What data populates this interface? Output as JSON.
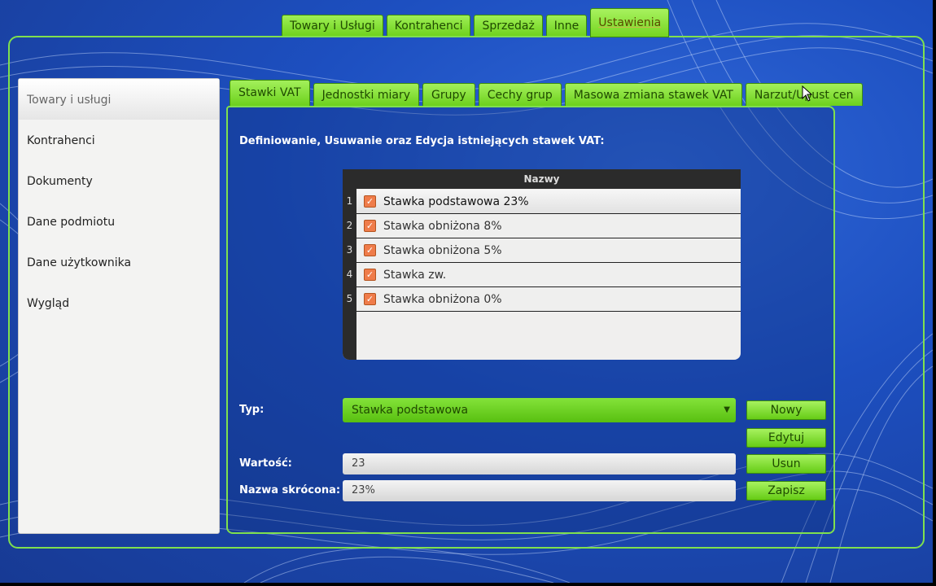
{
  "top_tabs": [
    {
      "label": "Towary i Usługi"
    },
    {
      "label": "Kontrahenci"
    },
    {
      "label": "Sprzedaż"
    },
    {
      "label": "Inne"
    },
    {
      "label": "Ustawienia"
    }
  ],
  "sidebar": {
    "items": [
      {
        "label": "Towary i usługi"
      },
      {
        "label": "Kontrahenci"
      },
      {
        "label": "Dokumenty"
      },
      {
        "label": "Dane podmiotu"
      },
      {
        "label": "Dane użytkownika"
      },
      {
        "label": "Wygląd"
      }
    ]
  },
  "inner_tabs": [
    {
      "label": "Stawki VAT"
    },
    {
      "label": "Jednostki miary"
    },
    {
      "label": "Grupy"
    },
    {
      "label": "Cechy grup"
    },
    {
      "label": "Masowa zmiana stawek VAT"
    },
    {
      "label": "Narzut/Upust cen"
    }
  ],
  "heading": "Definiowanie, Usuwanie oraz Edycja istniejących stawek VAT:",
  "table": {
    "header": "Nazwy",
    "rows": [
      {
        "num": "1",
        "label": "Stawka podstawowa 23%",
        "checked": true
      },
      {
        "num": "2",
        "label": "Stawka obniżona 8%",
        "checked": true
      },
      {
        "num": "3",
        "label": "Stawka obniżona 5%",
        "checked": true
      },
      {
        "num": "4",
        "label": "Stawka zw.",
        "checked": true
      },
      {
        "num": "5",
        "label": "Stawka obniżona 0%",
        "checked": true
      }
    ]
  },
  "form": {
    "typ_label": "Typ:",
    "typ_value": "Stawka podstawowa",
    "wartosc_label": "Wartość:",
    "wartosc_value": "23",
    "nazwa_label": "Nazwa skrócona:",
    "nazwa_value": "23%"
  },
  "buttons": {
    "nowy": "Nowy",
    "edytuj": "Edytuj",
    "usun": "Usun",
    "zapisz": "Zapisz"
  },
  "colors": {
    "accent_green": "#7fe04e",
    "checkbox_orange": "#ef7c4a",
    "background_blue": "#1d4fc0"
  }
}
